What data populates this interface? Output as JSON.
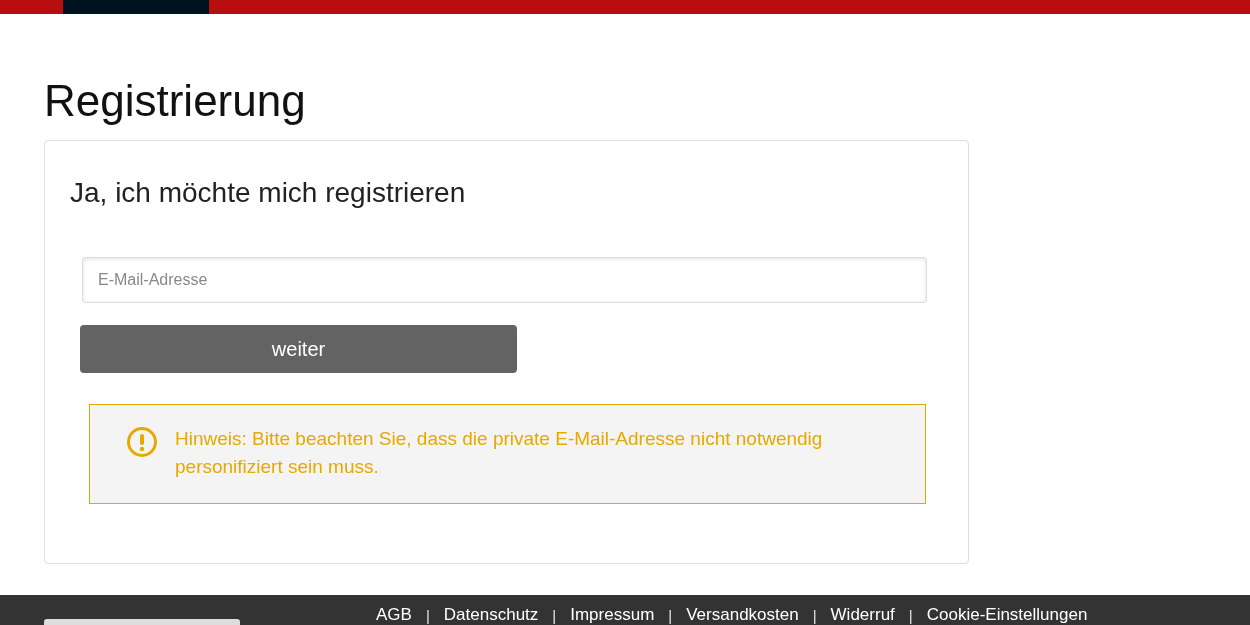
{
  "page": {
    "title": "Registrierung"
  },
  "card": {
    "heading": "Ja, ich möchte mich registrieren",
    "email": {
      "placeholder": "E-Mail-Adresse"
    },
    "button": "weiter",
    "notice": "Hinweis: Bitte beachten Sie, dass die private E-Mail-Adresse nicht notwendig personifiziert sein muss."
  },
  "footer": {
    "items": [
      {
        "kind": "link",
        "text": "AGB"
      },
      {
        "kind": "separator",
        "text": "|"
      },
      {
        "kind": "link",
        "text": "Datenschutz"
      },
      {
        "kind": "separator",
        "text": "|"
      },
      {
        "kind": "link",
        "text": "Impressum"
      },
      {
        "kind": "separator",
        "text": "|"
      },
      {
        "kind": "link",
        "text": "Versandkosten"
      },
      {
        "kind": "separator",
        "text": "|"
      },
      {
        "kind": "link",
        "text": "Widerruf"
      },
      {
        "kind": "separator",
        "text": "|"
      },
      {
        "kind": "link",
        "text": "Cookie-Einstellungen"
      }
    ]
  }
}
